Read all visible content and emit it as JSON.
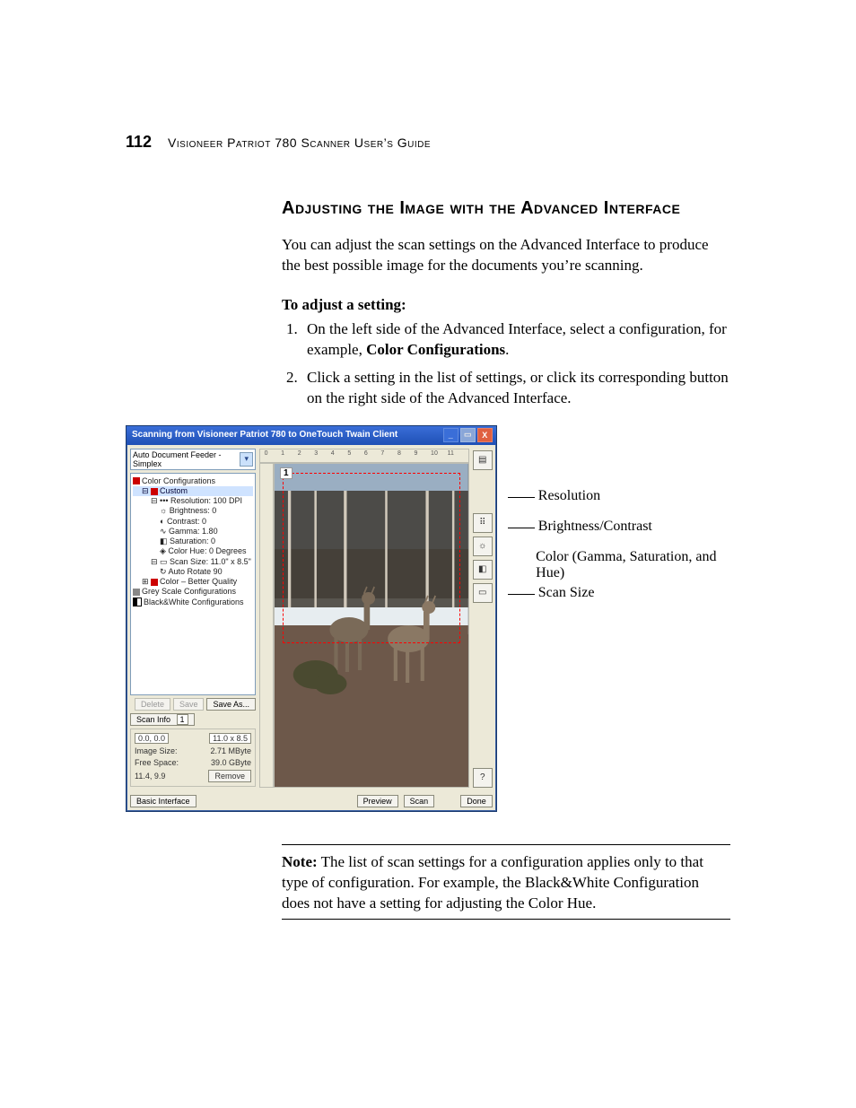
{
  "page_number": "112",
  "header": "Visioneer Patriot 780 Scanner User’s Guide",
  "heading": "Adjusting the Image with the Advanced Interface",
  "intro": "You can adjust the scan settings on the Advanced Interface to produce the best possible image for the documents you’re scanning.",
  "subheading": "To adjust a setting:",
  "steps": {
    "s1a": "On the left side of the Advanced Interface, select a configuration, for example, ",
    "s1b": "Color Configurations",
    "s1c": ".",
    "s2": "Click a setting in the list of settings, or click its corresponding button on the right side of the Advanced Interface."
  },
  "window": {
    "title": "Scanning from Visioneer Patriot 780 to OneTouch Twain Client",
    "minimize": "_",
    "maximize": "▭",
    "close": "X",
    "source_dropdown": "Auto Document Feeder - Simplex",
    "tree": {
      "color_config": "Color Configurations",
      "custom": "Custom",
      "resolution": "Resolution: 100 DPI",
      "brightness": "Brightness: 0",
      "contrast": "Contrast: 0",
      "gamma": "Gamma: 1.80",
      "saturation": "Saturation: 0",
      "hue": "Color Hue: 0 Degrees",
      "scan_size": "Scan Size: 11.0\" x 8.5\"",
      "auto_rotate": "Auto Rotate 90",
      "color_bq": "Color – Better Quality",
      "grey": "Grey Scale Configurations",
      "bw": "Black&White Configurations"
    },
    "buttons": {
      "delete": "Delete",
      "save": "Save",
      "save_as": "Save As...",
      "scan_info": "Scan Info",
      "remove": "Remove",
      "basic": "Basic Interface",
      "preview": "Preview",
      "scan": "Scan",
      "done": "Done"
    },
    "info": {
      "wh1": "0.0, 0.0",
      "wh2": "11.0 x 8.5",
      "image_size_label": "Image Size:",
      "image_size_value": "2.71 MByte",
      "free_space_label": "Free Space:",
      "free_space_value": "39.0 GByte",
      "ratio": "11.4, 9.9"
    },
    "ruler_h_numbers": [
      "0",
      "1",
      "2",
      "3",
      "4",
      "5",
      "6",
      "7",
      "8",
      "9",
      "10",
      "11"
    ],
    "corner_label": "1",
    "page_dropdown": "1"
  },
  "callouts": {
    "resolution": "Resolution",
    "brightness": "Brightness/Contrast",
    "color": "Color (Gamma, Saturation, and Hue)",
    "scan_size": "Scan Size"
  },
  "note_bold": "Note:",
  "note_text": " The list of scan settings for a configuration applies only to that type of configuration. For example, the Black&White Configuration does not have a setting for adjusting the Color Hue."
}
